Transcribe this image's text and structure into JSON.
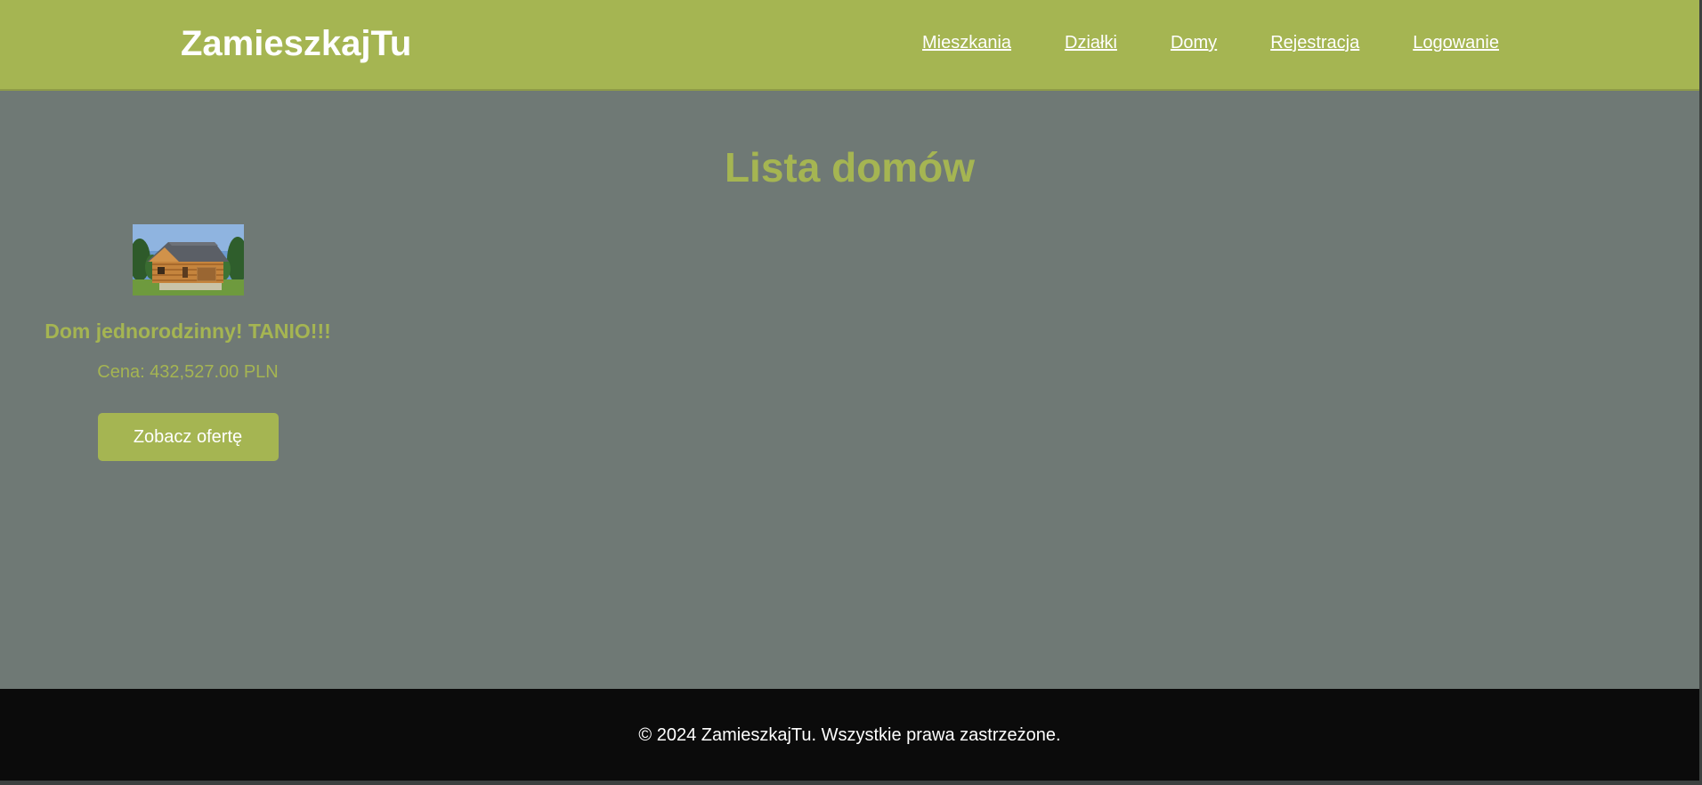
{
  "header": {
    "logo": "ZamieszkajTu",
    "nav": [
      {
        "label": "Mieszkania"
      },
      {
        "label": "Działki"
      },
      {
        "label": "Domy"
      },
      {
        "label": "Rejestracja"
      },
      {
        "label": "Logowanie"
      }
    ]
  },
  "main": {
    "title": "Lista domów",
    "listings": [
      {
        "title": "Dom jednorodzinny! TANIO!!!",
        "price": "Cena: 432,527.00 PLN",
        "button_label": "Zobacz ofertę"
      }
    ]
  },
  "footer": {
    "text": "© 2024 ZamieszkajTu. Wszystkie prawa zastrzeżone."
  },
  "colors": {
    "header_bg": "#a5b552",
    "page_bg": "#6f7975",
    "accent": "#a5b552",
    "footer_bg": "#0b0b0b",
    "text_light": "#ffffff"
  }
}
